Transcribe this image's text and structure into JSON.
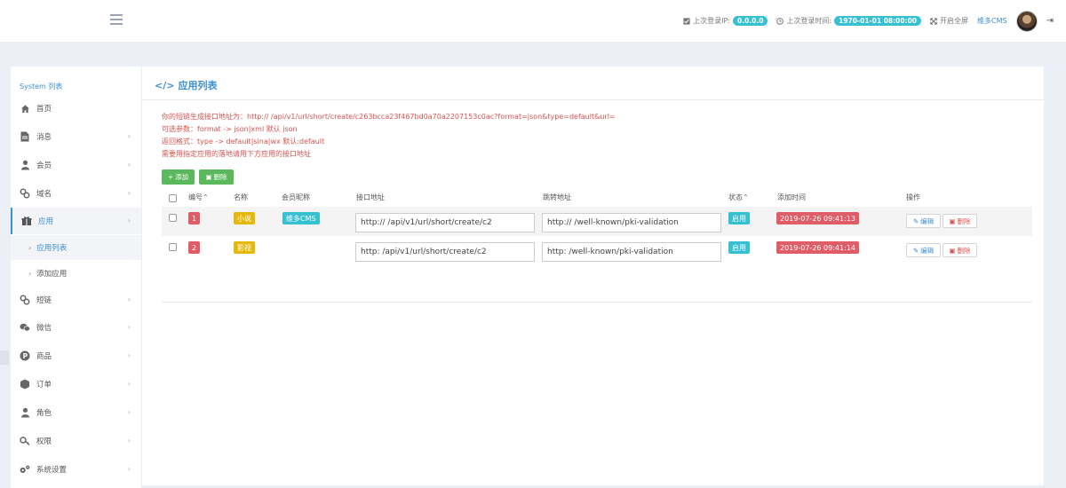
{
  "topbar": {
    "last_ip_label": "上次登录IP:",
    "last_ip_value": "0.0.0.0",
    "last_time_label": "上次登录时间:",
    "last_time_value": "1970-01-01 08:00:00",
    "fullscreen_label": "开启全屏",
    "user_name": "维多CMS"
  },
  "sidebar": {
    "title": "System 列表",
    "items": [
      {
        "label": "首页",
        "icon": "home-icon"
      },
      {
        "label": "消息",
        "icon": "document-icon"
      },
      {
        "label": "会员",
        "icon": "user-icon"
      },
      {
        "label": "域名",
        "icon": "link-icon"
      },
      {
        "label": "应用",
        "icon": "gift-icon"
      },
      {
        "label": "短链",
        "icon": "link-icon"
      },
      {
        "label": "微信",
        "icon": "wechat-icon"
      },
      {
        "label": "商品",
        "icon": "product-p-icon"
      },
      {
        "label": "订单",
        "icon": "cube-icon"
      },
      {
        "label": "角色",
        "icon": "user-icon"
      },
      {
        "label": "权限",
        "icon": "key-icon"
      },
      {
        "label": "系统设置",
        "icon": "gears-icon"
      }
    ],
    "sub_items": [
      {
        "label": "应用列表"
      },
      {
        "label": "添加应用"
      }
    ]
  },
  "main": {
    "title": "应用列表",
    "notes": [
      "你的短链生成接口地址为：http://                /api/v1/url/short/create/c263bcca23f467bd0a70a2207153c0ac?format=json&type=default&url=",
      "可选参数：format -> json|xml 默认 json",
      "返回格式：type -> default|sina|wx 默认:default",
      "需要用指定应用的落地请用下方应用的接口地址"
    ],
    "add_label": "添加",
    "delete_label": "删除",
    "columns": [
      "编号",
      "名称",
      "会员昵称",
      "接口地址",
      "跳转地址",
      "状态",
      "添加时间",
      "操作"
    ],
    "rows": [
      {
        "id": "1",
        "name": "小说",
        "member": "维多CMS",
        "api_url": "http://            /api/v1/url/short/create/c2",
        "jump_url": "http://              /well-known/pki-validation",
        "status": "启用",
        "added": "2019-07-26 09:41:13",
        "edit": "编辑",
        "del": "删除"
      },
      {
        "id": "2",
        "name": "影视",
        "member": "",
        "api_url": "http:              /api/v1/url/short/create/c2",
        "jump_url": "http:              /well-known/pki-validation",
        "status": "启用",
        "added": "2019-07-26 09:41:14",
        "edit": "编辑",
        "del": "删除"
      }
    ]
  },
  "colors": {
    "accent": "#3d8fd4",
    "teal": "#36c0d3",
    "danger": "#d9534f",
    "success": "#5cb85c",
    "warning": "#e7b80c"
  }
}
